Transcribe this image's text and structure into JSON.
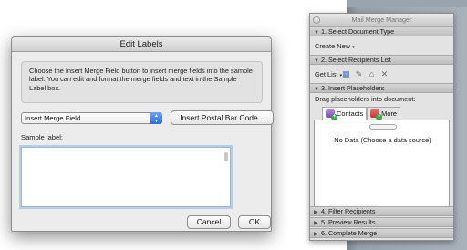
{
  "dialog": {
    "title": "Edit Labels",
    "instructions": "Choose the Insert Merge Field button to insert merge fields into the sample label.  You can edit and format the merge fields and text in the Sample Label box.",
    "merge_field_select": "Insert Merge Field",
    "postal_button": "Insert Postal Bar Code...",
    "sample_label": "Sample label:",
    "sample_text": "",
    "cancel": "Cancel",
    "ok": "OK"
  },
  "mail_merge_manager": {
    "title": "Mail Merge Manager",
    "sections": [
      {
        "label": "1. Select Document Type",
        "expanded": true
      },
      {
        "label": "2. Select Recipients List",
        "expanded": true
      },
      {
        "label": "3. Insert Placeholders",
        "expanded": true
      },
      {
        "label": "4. Filter Recipients",
        "expanded": false
      },
      {
        "label": "5. Preview Results",
        "expanded": false
      },
      {
        "label": "6. Complete Merge",
        "expanded": false
      }
    ],
    "create_new": "Create New",
    "get_list": "Get List",
    "drag_hint": "Drag placeholders into document:",
    "tabs": [
      {
        "label": "Contacts",
        "icon": "contacts-icon"
      },
      {
        "label": "More",
        "icon": "more-icon"
      }
    ],
    "no_data": "No Data (Choose a data source)",
    "icons": [
      "open-data-source-icon",
      "edit-data-icon",
      "header-icon",
      "clear-icon"
    ]
  },
  "colors": {
    "select_accent": "#2c6ede",
    "focus_ring": "#b7cdec",
    "desktop": "#9aa4ae"
  }
}
